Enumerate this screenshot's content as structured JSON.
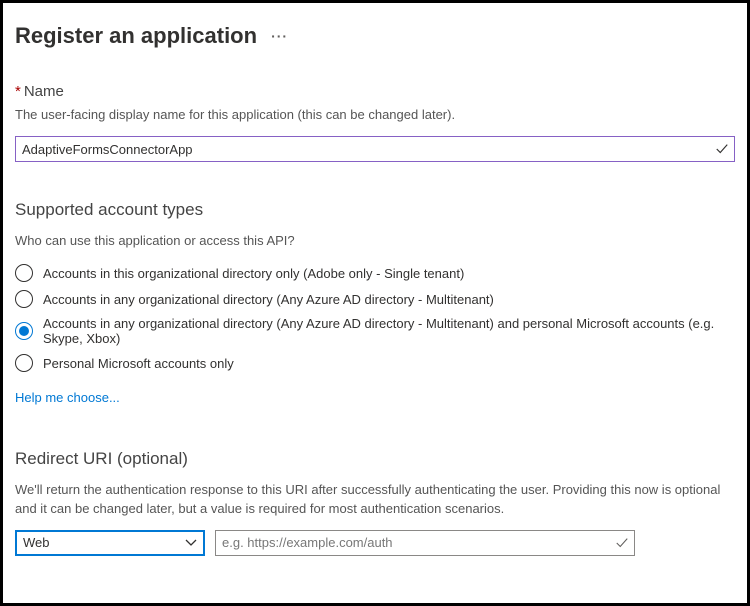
{
  "header": {
    "title": "Register an application"
  },
  "name_section": {
    "label": "Name",
    "hint": "The user-facing display name for this application (this can be changed later).",
    "value": "AdaptiveFormsConnectorApp"
  },
  "account_types": {
    "heading": "Supported account types",
    "question": "Who can use this application or access this API?",
    "options": [
      {
        "label": "Accounts in this organizational directory only (Adobe only - Single tenant)",
        "selected": false
      },
      {
        "label": "Accounts in any organizational directory (Any Azure AD directory - Multitenant)",
        "selected": false
      },
      {
        "label": "Accounts in any organizational directory (Any Azure AD directory - Multitenant) and personal Microsoft accounts (e.g. Skype, Xbox)",
        "selected": true
      },
      {
        "label": "Personal Microsoft accounts only",
        "selected": false
      }
    ],
    "help_link": "Help me choose..."
  },
  "redirect": {
    "heading": "Redirect URI (optional)",
    "hint": "We'll return the authentication response to this URI after successfully authenticating the user. Providing this now is optional and it can be changed later, but a value is required for most authentication scenarios.",
    "platform_selected": "Web",
    "uri_placeholder": "e.g. https://example.com/auth",
    "uri_value": ""
  }
}
